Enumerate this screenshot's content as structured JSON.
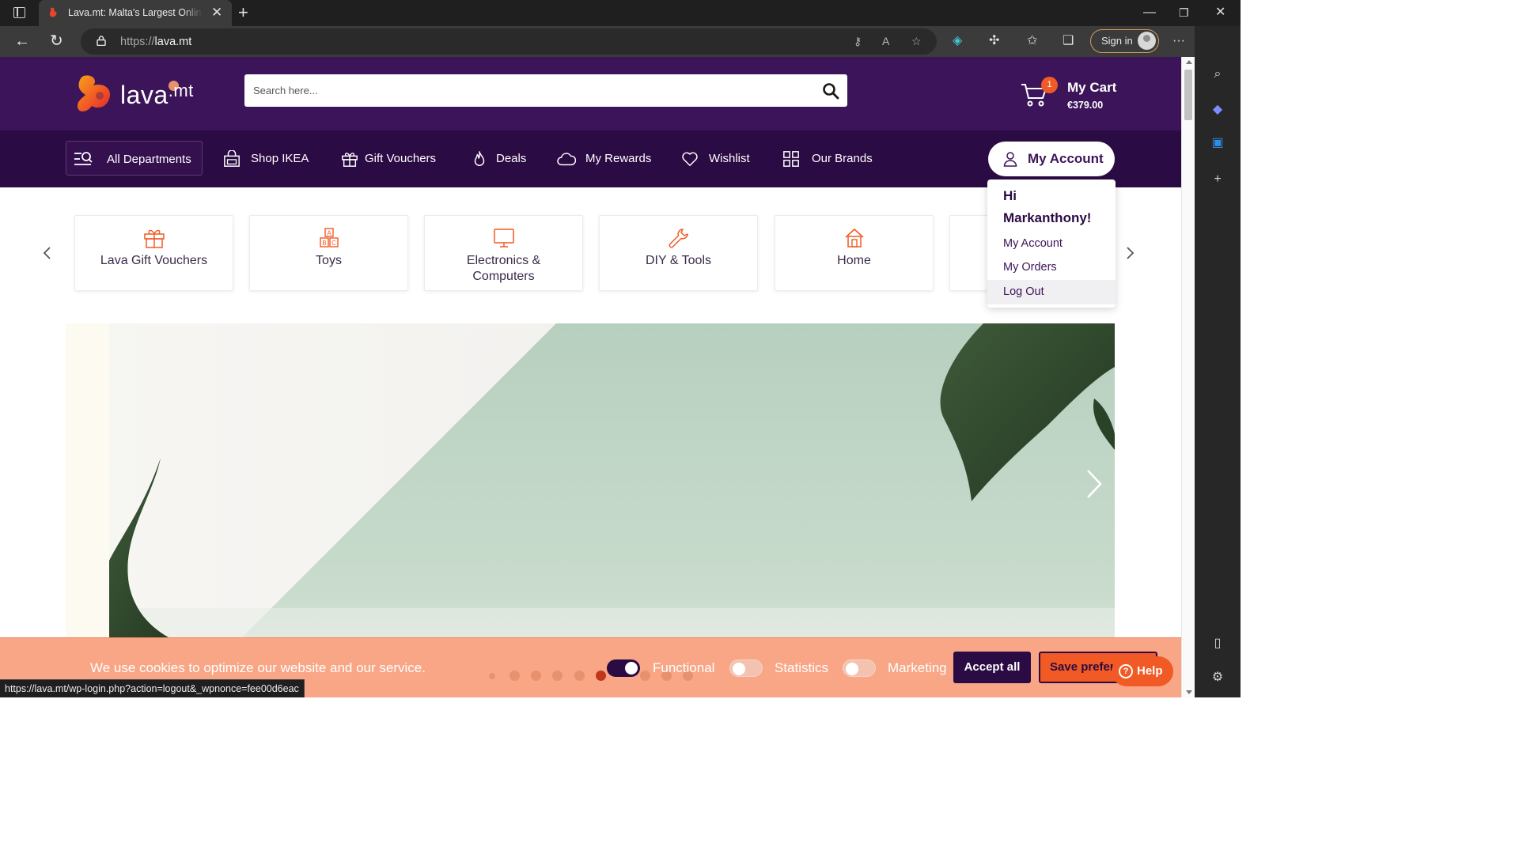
{
  "browser": {
    "tab_title": "Lava.mt: Malta's Largest Online M",
    "url_protocol": "https://",
    "url_host": "lava.mt",
    "signin_label": "Sign in",
    "status_url": "https://lava.mt/wp-login.php?action=logout&_wpnonce=fee00d6eac"
  },
  "header": {
    "logo_text": "lava",
    "logo_suffix": ".mt",
    "search_placeholder": "Search here...",
    "cart_label": "My Cart",
    "cart_total": "€379.00",
    "cart_count": "1"
  },
  "nav": {
    "all_departments": "All Departments",
    "shop_ikea": "Shop IKEA",
    "gift_vouchers": "Gift Vouchers",
    "deals": "Deals",
    "my_rewards": "My Rewards",
    "wishlist": "Wishlist",
    "our_brands": "Our Brands",
    "my_account": "My Account"
  },
  "account_menu": {
    "greeting": "Hi Markanthony!",
    "items": [
      "My Account",
      "My Orders",
      "Log Out"
    ]
  },
  "categories": [
    {
      "label": "Lava Gift Vouchers",
      "icon": "gift-icon"
    },
    {
      "label": "Toys",
      "icon": "abc-blocks-icon"
    },
    {
      "label": "Electronics & Computers",
      "icon": "monitor-icon"
    },
    {
      "label": "DIY & Tools",
      "icon": "wrench-icon"
    },
    {
      "label": "Home",
      "icon": "house-icon"
    }
  ],
  "cookie": {
    "message": "We use cookies to optimize our website and our service.",
    "toggles": [
      {
        "label": "Functional",
        "on": true
      },
      {
        "label": "Statistics",
        "on": false
      },
      {
        "label": "Marketing",
        "on": false
      }
    ],
    "accept_all": "Accept all",
    "save_preferences": "Save preferences"
  },
  "help_label": "Help",
  "colors": {
    "brand_purple": "#3c1459",
    "nav_purple": "#2b0b43",
    "accent_orange": "#f15a24",
    "cookie_bg": "#f8a686"
  }
}
